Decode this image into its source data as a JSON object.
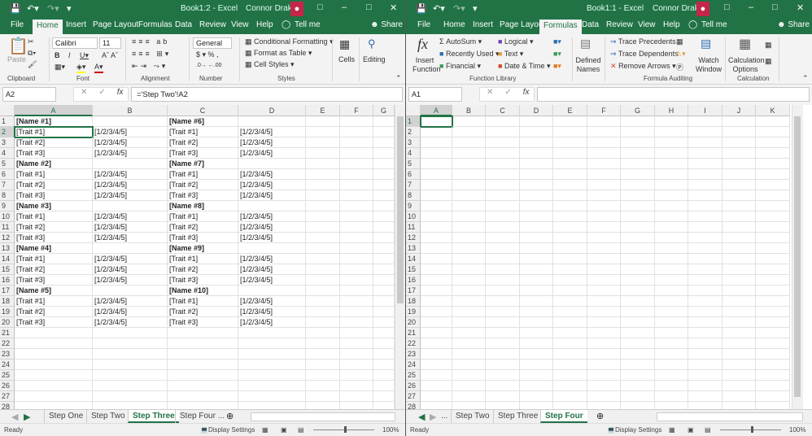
{
  "windows": [
    {
      "id": "w1",
      "title": "Book1:2  -  Excel",
      "user": "Connor Drake",
      "tabs": [
        "File",
        "Home",
        "Insert",
        "Page Layout",
        "Formulas",
        "Data",
        "Review",
        "View",
        "Help"
      ],
      "active_tab": "Home",
      "tell_me": "Tell me",
      "share": "Share",
      "ribbon": {
        "paste": "Paste",
        "font_name": "Calibri",
        "font_size": "11",
        "number_format": "General",
        "conditional_formatting": "Conditional Formatting",
        "format_as_table": "Format as Table",
        "cell_styles": "Cell Styles",
        "cells": "Cells",
        "editing": "Editing",
        "groups": [
          "Clipboard",
          "Font",
          "Alignment",
          "Number",
          "Styles"
        ]
      },
      "name_box": "A2",
      "formula": "='Step Two'!A2",
      "columns": [
        "A",
        "B",
        "C",
        "D",
        "E",
        "F",
        "G"
      ],
      "selected_col": "A",
      "selected_row": 2,
      "sheet_tabs": [
        "Step One",
        "Step Two",
        "Step Three",
        "Step Four ..."
      ],
      "active_sheet": "Step Three",
      "status": "Ready",
      "display_settings": "Display Settings",
      "zoom": "100%"
    },
    {
      "id": "w2",
      "title": "Book1:1  -  Excel",
      "user": "Connor Drake",
      "tabs": [
        "File",
        "Home",
        "Insert",
        "Page Layout",
        "Formulas",
        "Data",
        "Review",
        "View",
        "Help"
      ],
      "active_tab": "Formulas",
      "tell_me": "Tell me",
      "share": "Share",
      "ribbon": {
        "insert_function": "Insert Function",
        "autosum": "AutoSum",
        "recently_used": "Recently Used",
        "financial": "Financial",
        "logical": "Logical",
        "text": "Text",
        "date_time": "Date & Time",
        "defined_names": "Defined Names",
        "trace_precedents": "Trace Precedents",
        "trace_dependents": "Trace Dependents",
        "remove_arrows": "Remove Arrows",
        "watch_window": "Watch Window",
        "calculation_options": "Calculation Options",
        "groups": [
          "Function Library",
          "Formula Auditing",
          "Calculation"
        ]
      },
      "name_box": "A1",
      "formula": "",
      "columns": [
        "A",
        "B",
        "C",
        "D",
        "E",
        "F",
        "G",
        "H",
        "I",
        "J",
        "K"
      ],
      "selected_col": "A",
      "selected_row": 1,
      "sheet_tabs": [
        "...",
        "Step Two",
        "Step Three",
        "Step Four"
      ],
      "active_sheet": "Step Four",
      "status": "Ready",
      "display_settings": "Display Settings",
      "zoom": "100%"
    }
  ],
  "sheet_left": {
    "rows": [
      [
        "[Name #1]",
        "",
        "[Name #6]",
        ""
      ],
      [
        "[Trait #1]",
        "[1/2/3/4/5]",
        "[Trait #1]",
        "[1/2/3/4/5]"
      ],
      [
        "[Trait #2]",
        "[1/2/3/4/5]",
        "[Trait #2]",
        "[1/2/3/4/5]"
      ],
      [
        "[Trait #3]",
        "[1/2/3/4/5]",
        "[Trait #3]",
        "[1/2/3/4/5]"
      ],
      [
        "[Name #2]",
        "",
        "[Name #7]",
        ""
      ],
      [
        "[Trait #1]",
        "[1/2/3/4/5]",
        "[Trait #1]",
        "[1/2/3/4/5]"
      ],
      [
        "[Trait #2]",
        "[1/2/3/4/5]",
        "[Trait #2]",
        "[1/2/3/4/5]"
      ],
      [
        "[Trait #3]",
        "[1/2/3/4/5]",
        "[Trait #3]",
        "[1/2/3/4/5]"
      ],
      [
        "[Name #3]",
        "",
        "[Name #8]",
        ""
      ],
      [
        "[Trait #1]",
        "[1/2/3/4/5]",
        "[Trait #1]",
        "[1/2/3/4/5]"
      ],
      [
        "[Trait #2]",
        "[1/2/3/4/5]",
        "[Trait #2]",
        "[1/2/3/4/5]"
      ],
      [
        "[Trait #3]",
        "[1/2/3/4/5]",
        "[Trait #3]",
        "[1/2/3/4/5]"
      ],
      [
        "[Name #4]",
        "",
        "[Name #9]",
        ""
      ],
      [
        "[Trait #1]",
        "[1/2/3/4/5]",
        "[Trait #1]",
        "[1/2/3/4/5]"
      ],
      [
        "[Trait #2]",
        "[1/2/3/4/5]",
        "[Trait #2]",
        "[1/2/3/4/5]"
      ],
      [
        "[Trait #3]",
        "[1/2/3/4/5]",
        "[Trait #3]",
        "[1/2/3/4/5]"
      ],
      [
        "[Name #5]",
        "",
        "[Name #10]",
        ""
      ],
      [
        "[Trait #1]",
        "[1/2/3/4/5]",
        "[Trait #1]",
        "[1/2/3/4/5]"
      ],
      [
        "[Trait #2]",
        "[1/2/3/4/5]",
        "[Trait #2]",
        "[1/2/3/4/5]"
      ],
      [
        "[Trait #3]",
        "[1/2/3/4/5]",
        "[Trait #3]",
        "[1/2/3/4/5]"
      ]
    ]
  },
  "row_count": 28
}
